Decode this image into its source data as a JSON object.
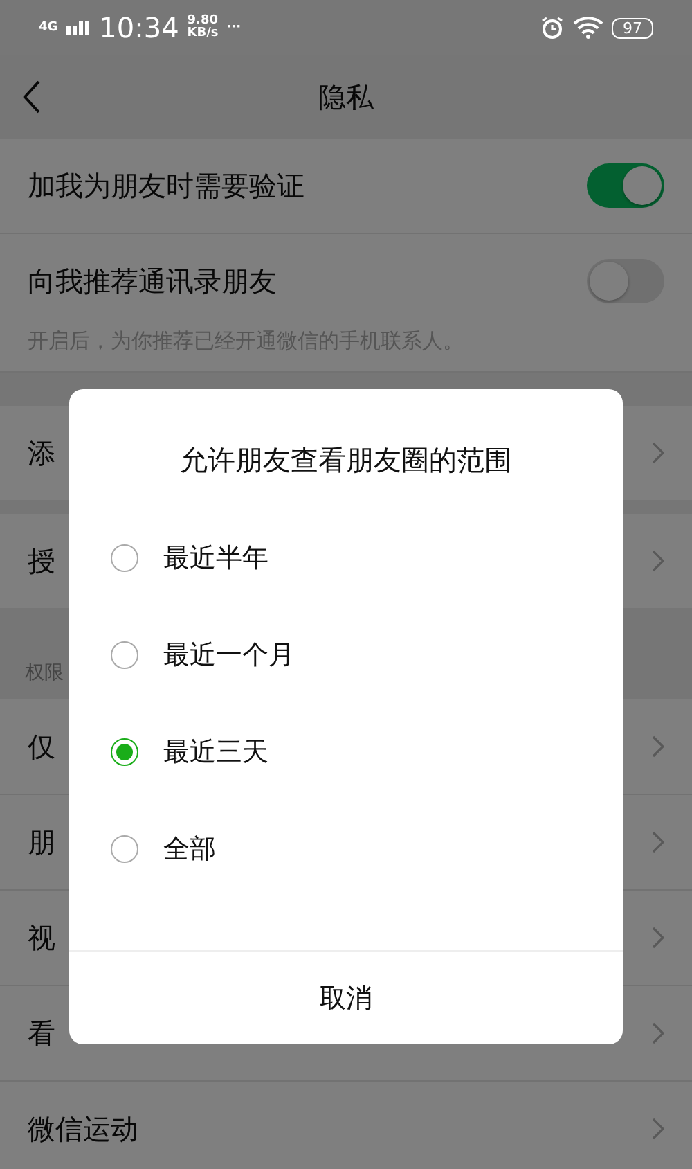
{
  "status_bar": {
    "network": "4G",
    "time": "10:34",
    "speed": "9.80",
    "speed_unit": "KB/s",
    "more": "···",
    "battery": "97"
  },
  "nav": {
    "title": "隐私"
  },
  "sections": [
    {
      "rows": [
        {
          "label": "加我为朋友时需要验证",
          "kind": "toggle",
          "on": true
        },
        {
          "label": "向我推荐通讯录朋友",
          "kind": "toggle",
          "on": false,
          "hint": "开启后，为你推荐已经开通微信的手机联系人。"
        }
      ]
    },
    {
      "rows": [
        {
          "label": "添",
          "kind": "link"
        }
      ]
    },
    {
      "rows": [
        {
          "label": "授",
          "kind": "link"
        }
      ]
    },
    {
      "header": "权限",
      "rows": [
        {
          "label": "仅",
          "kind": "link"
        },
        {
          "label": "朋",
          "kind": "link"
        },
        {
          "label": "视",
          "kind": "link"
        },
        {
          "label": "看",
          "kind": "link"
        },
        {
          "label": "微信运动",
          "kind": "link"
        }
      ]
    }
  ],
  "dialog": {
    "title": "允许朋友查看朋友圈的范围",
    "options": [
      {
        "label": "最近半年",
        "selected": false
      },
      {
        "label": "最近一个月",
        "selected": false
      },
      {
        "label": "最近三天",
        "selected": true
      },
      {
        "label": "全部",
        "selected": false
      }
    ],
    "cancel": "取消"
  }
}
